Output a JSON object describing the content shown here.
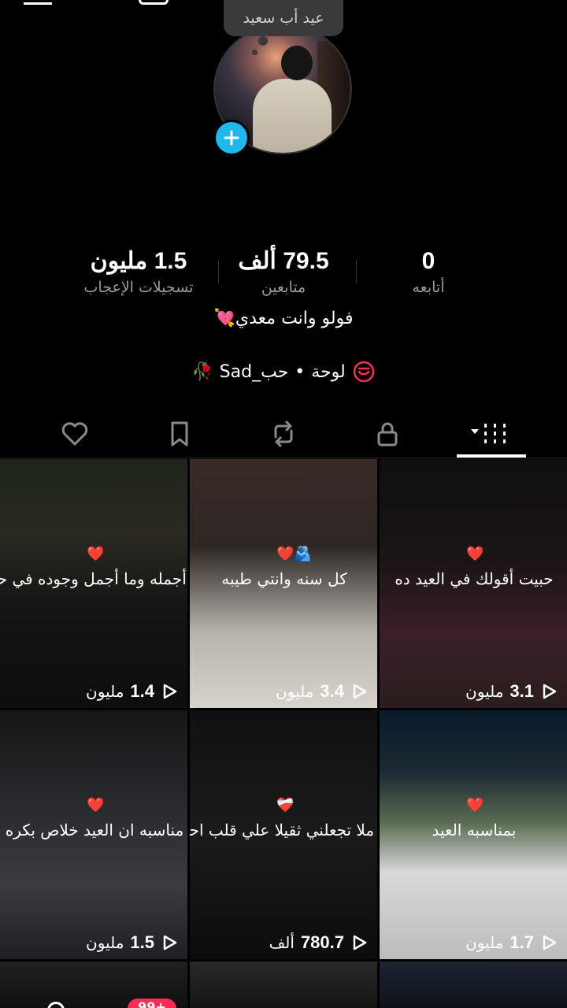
{
  "profile": {
    "note": "عيد أب سعيد",
    "bio": "فولو وانت معدي",
    "bio_emoji": "💘",
    "playlist_label": "لوحة",
    "playlist_separator": "•",
    "playlist_name": "Sad_حب",
    "playlist_emoji": "🥀"
  },
  "stats": {
    "following": {
      "value": "0",
      "label": "أتابعه"
    },
    "followers": {
      "value": "79.5 ألف",
      "label": "متابعين"
    },
    "likes": {
      "value": "1.5 مليون",
      "label": "تسجيلات الإعجاب"
    }
  },
  "tabs": [
    {
      "name": "videos",
      "icon": "grid-icon",
      "active": true
    },
    {
      "name": "private",
      "icon": "lock-icon"
    },
    {
      "name": "reposts",
      "icon": "repost-icon"
    },
    {
      "name": "favorites",
      "icon": "bookmark-icon"
    },
    {
      "name": "liked",
      "icon": "heart-icon"
    }
  ],
  "videos": [
    {
      "caption": "حبيت أقولك في العيد ده",
      "views": "3.1",
      "unit": "مليون",
      "heart": "❤️"
    },
    {
      "caption": "كل سنه وانتي طيبه",
      "views": "3.4",
      "unit": "مليون",
      "heart": "❤️🫂"
    },
    {
      "caption": "ما أجمله وما أجمل وجوده في حي",
      "views": "1.4",
      "unit": "مليون",
      "heart": "❤️"
    },
    {
      "caption": "بمناسبه العيد",
      "views": "1.7",
      "unit": "مليون",
      "heart": "❤️"
    },
    {
      "caption": "ه ملا تجعلني ثقيلا علي قلب احد",
      "views": "780.7",
      "unit": "ألف",
      "heart": "❤️‍🩹"
    },
    {
      "caption": "مناسبه ان العيد خلاص بكره",
      "views": "1.5",
      "unit": "مليون",
      "heart": "❤️"
    }
  ],
  "bottom": {
    "badge": "99+"
  },
  "colors": {
    "accent": "#20b8e8",
    "badge": "#ff2d55",
    "muted": "#9a9a9a"
  }
}
